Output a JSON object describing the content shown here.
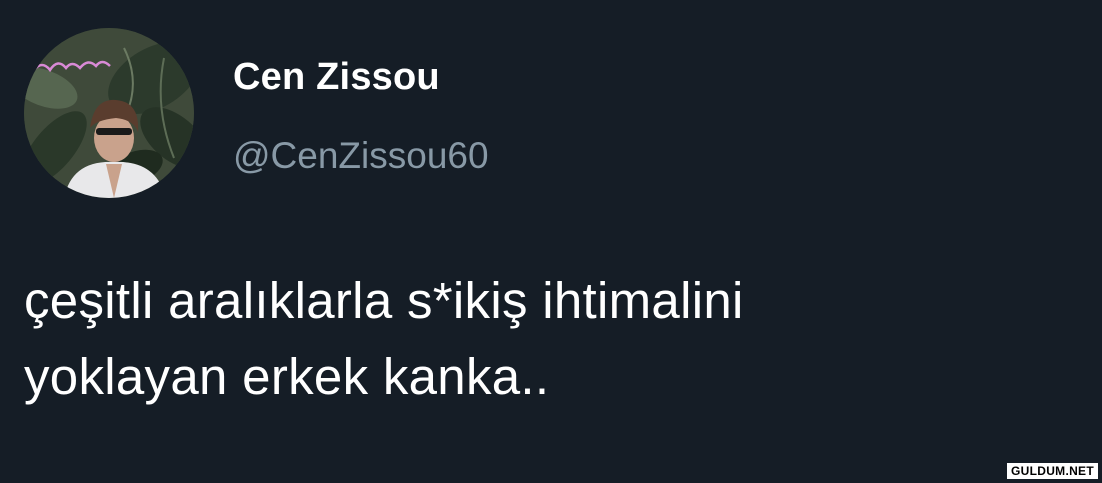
{
  "tweet": {
    "author": {
      "display_name": "Cen Zissou",
      "handle": "@CenZissou60"
    },
    "text_lines": [
      "çeşitli aralıklarla s*ikiş ihtimalini",
      "yoklayan erkek kanka.."
    ]
  },
  "watermark": "GULDUM.NET",
  "colors": {
    "background": "#151d26",
    "primary_text": "#ffffff",
    "secondary_text": "#8899a6"
  }
}
